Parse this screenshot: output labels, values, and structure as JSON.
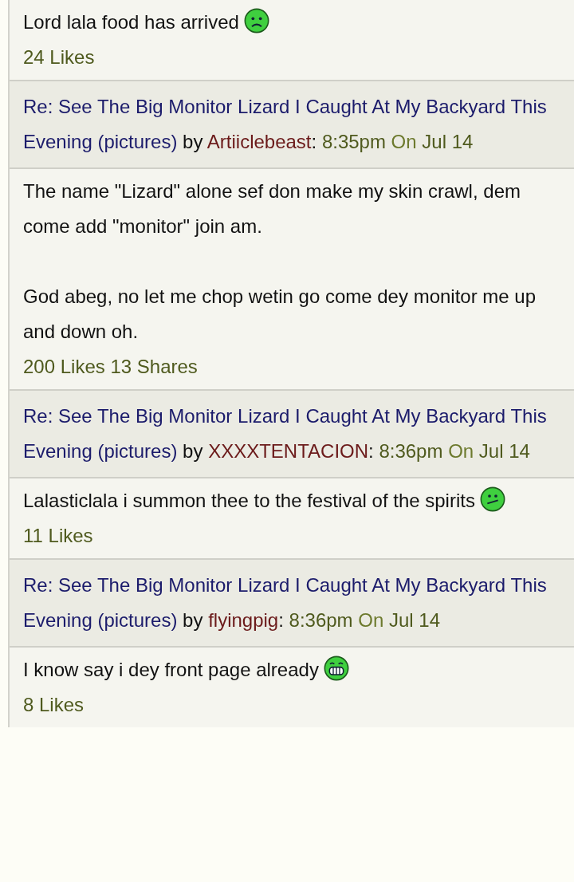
{
  "items": [
    {
      "kind": "body",
      "paragraphs": [
        "Lord lala food has arrived"
      ],
      "smiley": {
        "kind": "sad"
      },
      "likes": "24 Likes"
    },
    {
      "kind": "header",
      "topic": "Re: See The Big Monitor Lizard I Caught At My Backyard This Evening (pictures)",
      "by": "by",
      "author": "Artiiclebeast",
      "sep": ":",
      "time": "8:35pm",
      "on": "On",
      "date": "Jul 14"
    },
    {
      "kind": "body",
      "paragraphs": [
        "The name \"Lizard\" alone sef don make my skin crawl, dem come add \"monitor\" join am.",
        "God abeg, no let me chop wetin go come dey monitor me up and down oh."
      ],
      "likes": "200 Likes",
      "shares": "13 Shares"
    },
    {
      "kind": "header",
      "topic": "Re: See The Big Monitor Lizard I Caught At My Backyard This Evening (pictures)",
      "by": "by",
      "author": "XXXXTENTACION",
      "sep": ":",
      "time": "8:36pm",
      "on": "On",
      "date": "Jul 14"
    },
    {
      "kind": "body",
      "paragraphs": [
        "Lalasticlala i summon thee to the festival of the spirits"
      ],
      "smiley": {
        "kind": "smirk"
      },
      "likes": "11 Likes"
    },
    {
      "kind": "header",
      "topic": "Re: See The Big Monitor Lizard I Caught At My Backyard This Evening (pictures)",
      "by": "by",
      "author": "flyingpig",
      "sep": ":",
      "time": "8:36pm",
      "on": "On",
      "date": "Jul 14"
    },
    {
      "kind": "body",
      "paragraphs": [
        "I know say i dey front page already"
      ],
      "smiley": {
        "kind": "grin"
      },
      "likes": "8 Likes"
    }
  ]
}
